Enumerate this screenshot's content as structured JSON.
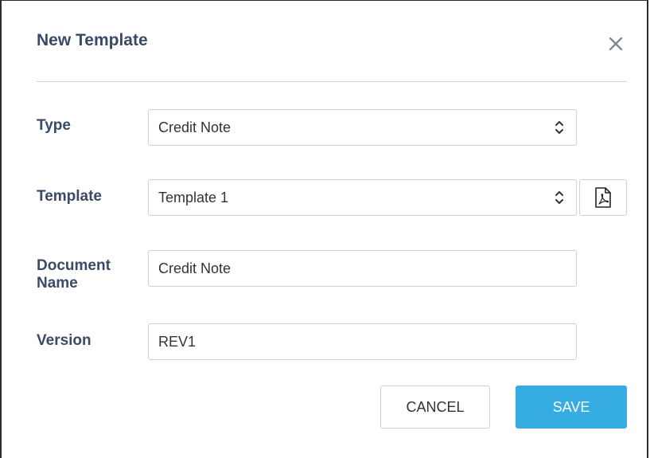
{
  "dialog": {
    "title": "New Template",
    "close_icon": "close-icon"
  },
  "form": {
    "type": {
      "label": "Type",
      "value": "Credit Note"
    },
    "template": {
      "label": "Template",
      "value": "Template 1",
      "pdf_icon": "pdf-file-icon"
    },
    "document_name": {
      "label_line1": "Document",
      "label_line2": "Name",
      "value": "Credit Note"
    },
    "version": {
      "label": "Version",
      "value": "REV1"
    }
  },
  "buttons": {
    "cancel": "CANCEL",
    "save": "SAVE"
  },
  "colors": {
    "label": "#3a4a66",
    "accent": "#35ade2",
    "border": "#cdd1d6"
  }
}
